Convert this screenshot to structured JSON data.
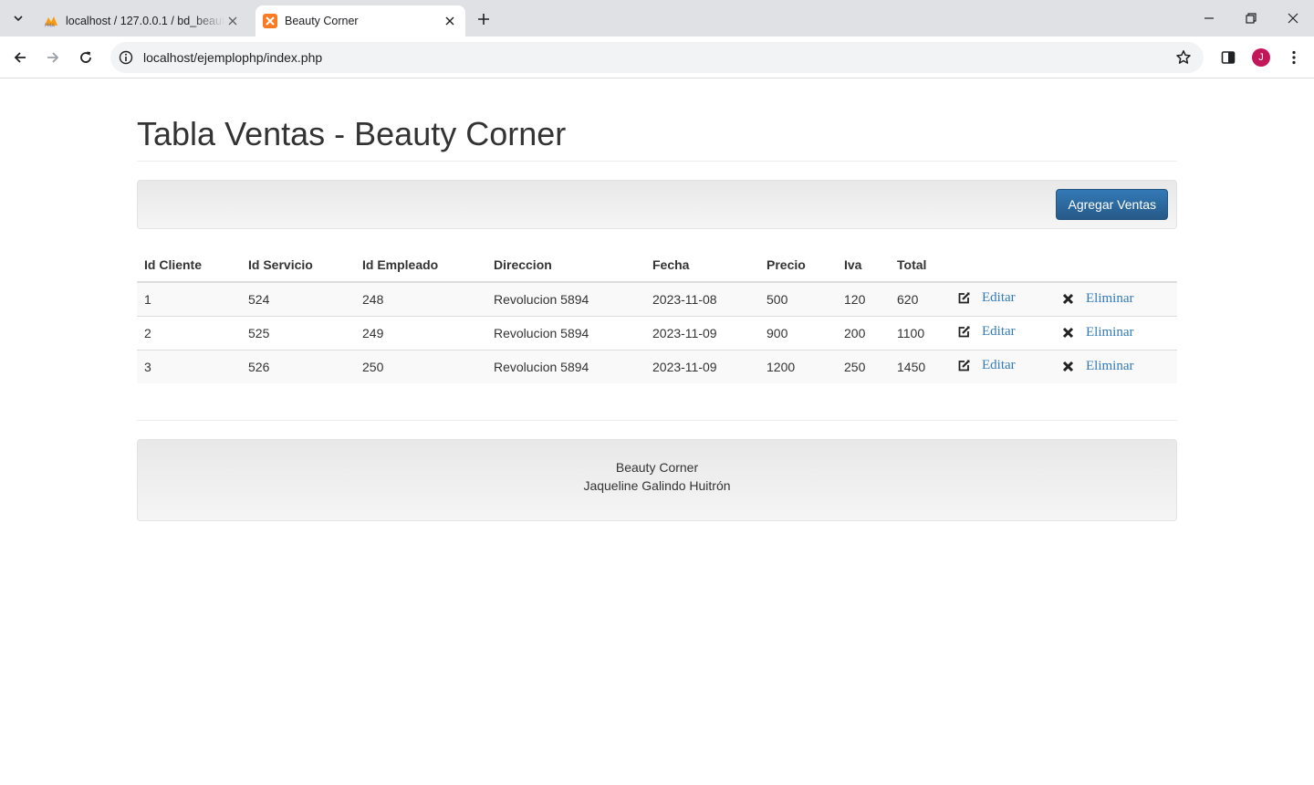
{
  "browser": {
    "tabs": [
      {
        "title": "localhost / 127.0.0.1 / bd_beauty",
        "active": false
      },
      {
        "title": "Beauty Corner",
        "active": true
      }
    ],
    "url": "localhost/ejemplophp/index.php",
    "profile_initial": "J",
    "colors": {
      "tabstrip": "#dfe1e5",
      "avatar": "#c2185b"
    }
  },
  "page": {
    "title": "Tabla Ventas - Beauty Corner",
    "add_button": "Agregar Ventas",
    "table": {
      "headers": [
        "Id Cliente",
        "Id Servicio",
        "Id Empleado",
        "Direccion",
        "Fecha",
        "Precio",
        "Iva",
        "Total"
      ],
      "rows": [
        {
          "id_cliente": "1",
          "id_servicio": "524",
          "id_empleado": "248",
          "direccion": "Revolucion 5894",
          "fecha": "2023-11-08",
          "precio": "500",
          "iva": "120",
          "total": "620"
        },
        {
          "id_cliente": "2",
          "id_servicio": "525",
          "id_empleado": "249",
          "direccion": "Revolucion 5894",
          "fecha": "2023-11-09",
          "precio": "900",
          "iva": "200",
          "total": "1100"
        },
        {
          "id_cliente": "3",
          "id_servicio": "526",
          "id_empleado": "250",
          "direccion": "Revolucion 5894",
          "fecha": "2023-11-09",
          "precio": "1200",
          "iva": "250",
          "total": "1450"
        }
      ],
      "edit_label": "Editar",
      "delete_label": "Eliminar"
    },
    "footer": {
      "line1": "Beauty Corner",
      "line2": "Jaqueline Galindo Huitrón"
    },
    "colors": {
      "primary": "#337ab7",
      "stripe": "#f9f9f9"
    }
  }
}
